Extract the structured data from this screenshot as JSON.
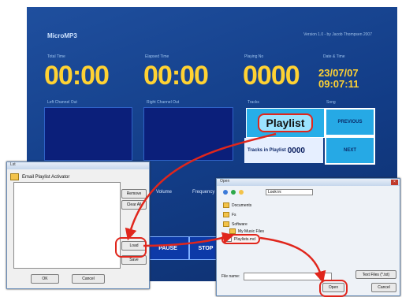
{
  "player": {
    "title": "MicroMP3",
    "version": "Version 1.0 - by Jacob Thompsen 2007",
    "labels": {
      "total_time": "Total Time",
      "elapsed_time": "Elapsed Time",
      "playing_no": "Playing No",
      "date_time": "Date & Time",
      "left_channel": "Left Channel Out",
      "right_channel": "Right Channel Out",
      "tracks": "Tracks",
      "song": "Song"
    },
    "total_time": "00:00",
    "elapsed_time": "00:00",
    "playing_no": "0000",
    "date": "23/07/07",
    "time": "09:07:11",
    "playlist_button": "Playlist",
    "previous_button": "PREVIOUS",
    "next_button": "NEXT",
    "tracks_label": "Tracks in Playlist",
    "tracks_count": "0000",
    "mid_labels": [
      "Volume",
      "Frequency"
    ],
    "bottom_buttons": [
      "PAUSE",
      "STOP"
    ]
  },
  "playlist_dialog": {
    "title": "Lst",
    "header": "Email Playlist Activator",
    "side_buttons": [
      "Remove",
      "Clear All",
      "Load",
      "Save"
    ],
    "ok_button": "OK",
    "cancel_button": "Cancel"
  },
  "open_dialog": {
    "title": "Open",
    "address": "Look in:",
    "files": [
      "Documents",
      "Fs",
      "Software",
      "My Music Files",
      "Playlists.mcl"
    ],
    "filename_label": "File name:",
    "filetype": "Text Files (*.txt)",
    "open_button": "Open",
    "cancel_button": "Cancel"
  },
  "colors": {
    "player_bg": "#123c86",
    "time_yellow": "#ffd233",
    "button_cyan": "#26a9e5",
    "highlight_red": "#e0261c"
  }
}
